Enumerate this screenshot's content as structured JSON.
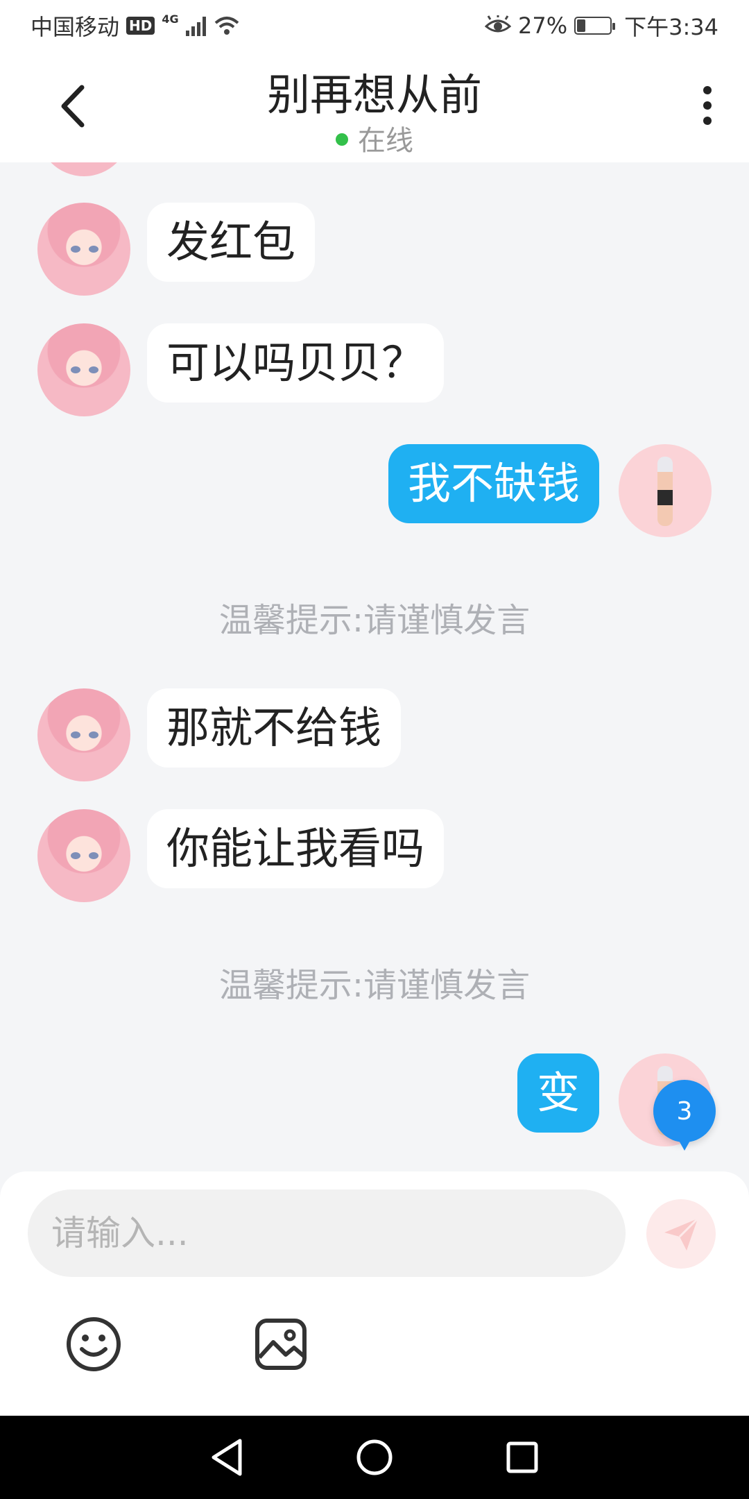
{
  "status_bar": {
    "carrier": "中国移动",
    "hd": "HD",
    "network": "4G",
    "battery": "27%",
    "battery_level": 0.27,
    "time": "下午3:34"
  },
  "header": {
    "title": "别再想从前",
    "status": "在线"
  },
  "messages": [
    {
      "side": "in",
      "text": "发红包"
    },
    {
      "side": "in",
      "text": "可以吗贝贝？"
    },
    {
      "side": "out",
      "text": "我不缺钱"
    },
    {
      "side": "tip",
      "text": "温馨提示:请谨慎发言"
    },
    {
      "side": "in",
      "text": "那就不给钱"
    },
    {
      "side": "in",
      "text": "你能让我看吗"
    },
    {
      "side": "tip",
      "text": "温馨提示:请谨慎发言"
    },
    {
      "side": "out",
      "text": "变"
    }
  ],
  "unread_badge": "3",
  "input": {
    "placeholder": "请输入...",
    "value": ""
  },
  "icons": {
    "back": "chevron-left-icon",
    "more": "more-vertical-icon",
    "send": "send-icon",
    "emoji": "emoji-icon",
    "image": "image-icon"
  },
  "colors": {
    "accent": "#1fb0f2",
    "online": "#33c04a",
    "badge": "#1e8ff0",
    "background": "#f4f5f7"
  }
}
